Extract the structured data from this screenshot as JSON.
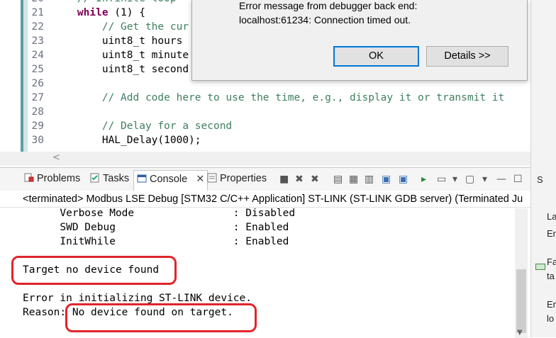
{
  "editor": {
    "lines": [
      {
        "n": "20",
        "parts": [
          [
            "cm",
            "    // Infinite loop"
          ]
        ]
      },
      {
        "n": "21",
        "parts": [
          [
            "kw",
            "    while"
          ],
          [
            "",
            "(1) {"
          ]
        ]
      },
      {
        "n": "22",
        "parts": [
          [
            "cm",
            "        // Get the cur"
          ]
        ]
      },
      {
        "n": "23",
        "parts": [
          [
            "",
            "        uint8_t hours"
          ]
        ]
      },
      {
        "n": "24",
        "parts": [
          [
            "",
            "        uint8_t minute"
          ]
        ]
      },
      {
        "n": "25",
        "parts": [
          [
            "",
            "        uint8_t second"
          ]
        ]
      },
      {
        "n": "26",
        "parts": []
      },
      {
        "n": "27",
        "parts": [
          [
            "cm",
            "        // Add code here to use the time, e.g., display it or transmit it"
          ]
        ]
      },
      {
        "n": "28",
        "parts": []
      },
      {
        "n": "29",
        "parts": [
          [
            "cm",
            "        // Delay for a second"
          ]
        ]
      },
      {
        "n": "30",
        "parts": [
          [
            "",
            "        HAL_Delay(1000);"
          ]
        ]
      }
    ]
  },
  "dialog": {
    "line1": "Error message from debugger back end:",
    "line2": "localhost:61234: Connection timed out.",
    "ok_label": "OK",
    "details_label": "Details >>"
  },
  "views": {
    "tabs": {
      "problems": "Problems",
      "tasks": "Tasks",
      "console": "Console",
      "properties": "Properties"
    },
    "terminated": "<terminated> Modbus LSE Debug [STM32 C/C++ Application] ST-LINK (ST-LINK GDB server) (Terminated Ju"
  },
  "console": {
    "lines": [
      "      Verbose Mode                : Disabled",
      "      SWD Debug                   : Enabled",
      "      InitWhile                   : Enabled",
      "",
      "Target no device found",
      "",
      "Error in initializing ST-LINK device.",
      "Reason: No device found on target."
    ]
  },
  "right_strip": {
    "tab": "S",
    "items": [
      "La",
      "Er",
      "Fa",
      "ta",
      "Er",
      "lo"
    ]
  },
  "colors": {
    "annotation": "#e0252b",
    "keyword": "#7f0055",
    "comment": "#3f7f5f",
    "focus": "#0078d7"
  }
}
